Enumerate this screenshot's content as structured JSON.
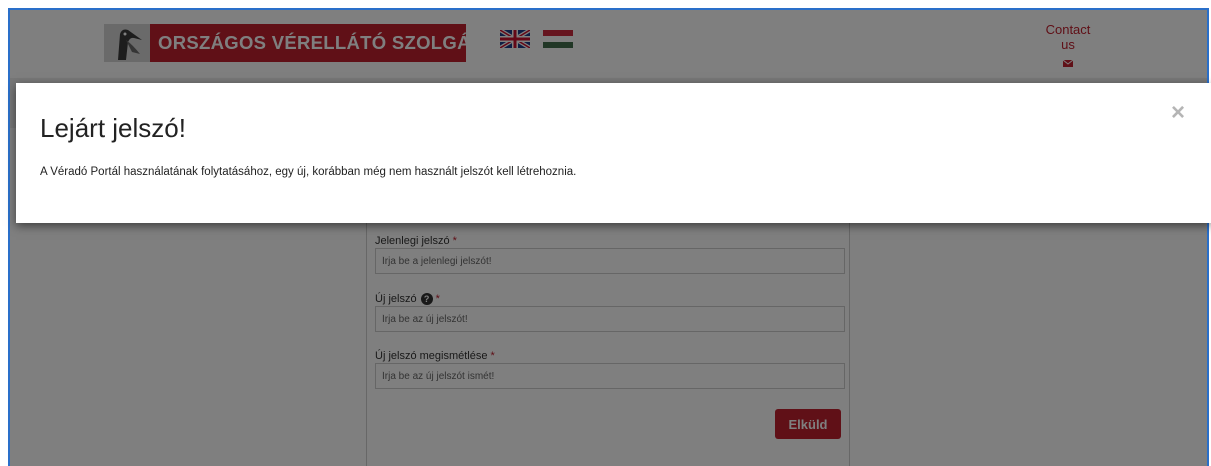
{
  "header": {
    "logo_text": "ORSZÁGOS VÉRELLÁTÓ SZOLGÁLAT",
    "contact_label": "Contact us"
  },
  "form": {
    "current_password": {
      "label": "Jelenlegi jelszó",
      "required_mark": "*",
      "placeholder": "Írja be a jelenlegi jelszót!"
    },
    "new_password": {
      "label": "Új jelszó",
      "help_mark": "?",
      "required_mark": "*",
      "placeholder": "Írja be az új jelszót!"
    },
    "confirm_password": {
      "label": "Új jelszó megismétlése",
      "required_mark": "*",
      "placeholder": "Írja be az új jelszót ismét!"
    },
    "submit_label": "Elküld"
  },
  "modal": {
    "title": "Lejárt jelszó!",
    "body": "A Véradó Portál használatának folytatásához, egy új, korábban még nem használt jelszót kell létrehoznia.",
    "close_symbol": "×"
  },
  "colors": {
    "brand": "#c0202f",
    "backdrop": "rgba(0,0,0,0.5)"
  },
  "icons": {
    "logo": "pelican-logo-icon",
    "english": "uk-flag-icon",
    "hungarian": "hungary-flag-icon",
    "contact": "envelope-icon",
    "help": "question-circle-icon",
    "close": "close-icon"
  }
}
